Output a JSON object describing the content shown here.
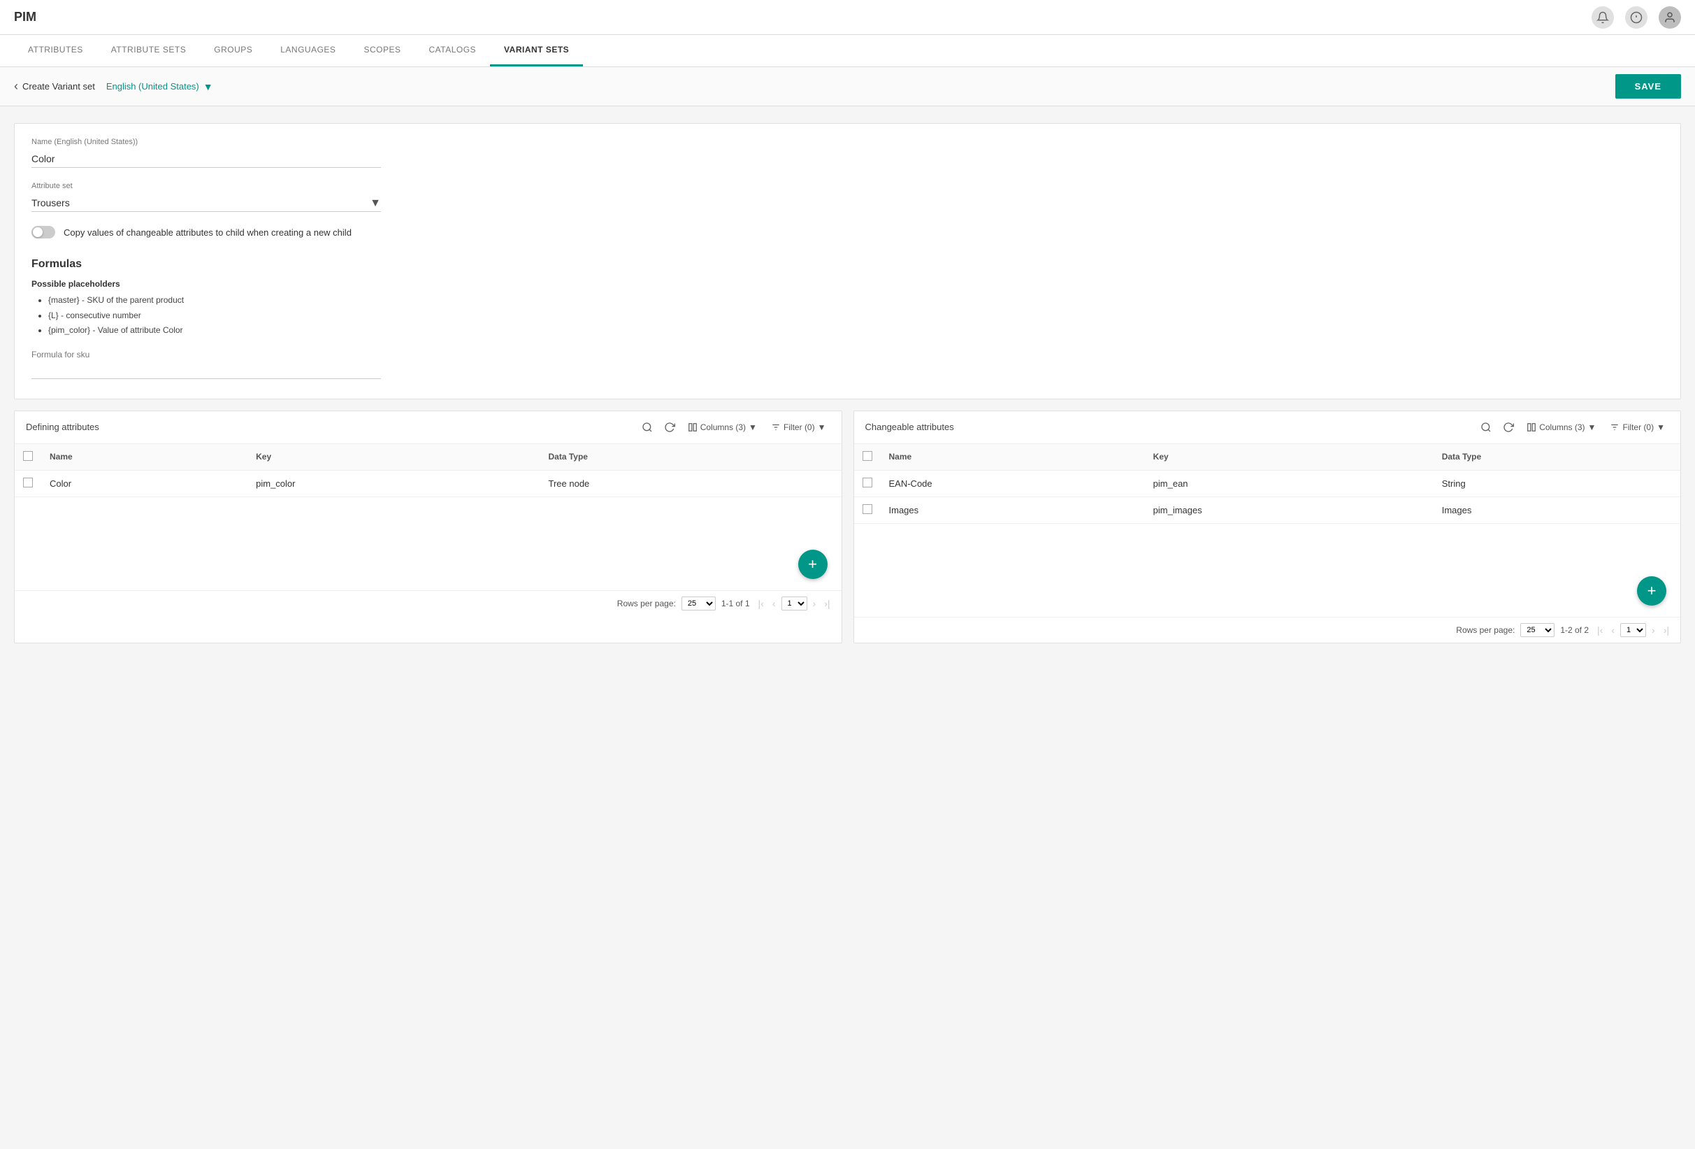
{
  "app": {
    "title": "PIM"
  },
  "nav": {
    "tabs": [
      {
        "id": "attributes",
        "label": "ATTRIBUTES",
        "active": false
      },
      {
        "id": "attribute-sets",
        "label": "ATTRIBUTE SETS",
        "active": false
      },
      {
        "id": "groups",
        "label": "GROUPS",
        "active": false
      },
      {
        "id": "languages",
        "label": "LANGUAGES",
        "active": false
      },
      {
        "id": "scopes",
        "label": "SCOPES",
        "active": false
      },
      {
        "id": "catalogs",
        "label": "CATALOGS",
        "active": false
      },
      {
        "id": "variant-sets",
        "label": "VARIANT SETS",
        "active": true
      }
    ]
  },
  "toolbar": {
    "back_label": "Create Variant set",
    "language": "English (United States)",
    "save_label": "SAVE"
  },
  "form": {
    "name_label": "Name (English (United States))",
    "name_value": "Color",
    "attribute_set_label": "Attribute set",
    "attribute_set_value": "Trousers",
    "toggle_label": "Copy values of changeable attributes to child when creating a new child"
  },
  "formulas": {
    "title": "Formulas",
    "placeholders_title": "Possible placeholders",
    "placeholders": [
      "{master} - SKU of the parent product",
      "{L} - consecutive number",
      "{pim_color} - Value of attribute Color"
    ],
    "formula_for_sku_label": "Formula for sku"
  },
  "defining_table": {
    "title": "Defining attributes",
    "columns_label": "Columns (3)",
    "filter_label": "Filter (0)",
    "headers": [
      "Name",
      "Key",
      "Data Type"
    ],
    "rows": [
      {
        "name": "Color",
        "key": "pim_color",
        "data_type": "Tree node"
      }
    ],
    "rows_per_page": "25",
    "pagination_info": "1-1 of 1",
    "page_current": "1"
  },
  "changeable_table": {
    "title": "Changeable attributes",
    "columns_label": "Columns (3)",
    "filter_label": "Filter (0)",
    "headers": [
      "Name",
      "Key",
      "Data Type"
    ],
    "rows": [
      {
        "name": "EAN-Code",
        "key": "pim_ean",
        "data_type": "String"
      },
      {
        "name": "Images",
        "key": "pim_images",
        "data_type": "Images"
      }
    ],
    "rows_per_page": "25",
    "pagination_info": "1-2 of 2",
    "page_current": "1"
  },
  "colors": {
    "teal": "#009688",
    "white": "#ffffff"
  }
}
